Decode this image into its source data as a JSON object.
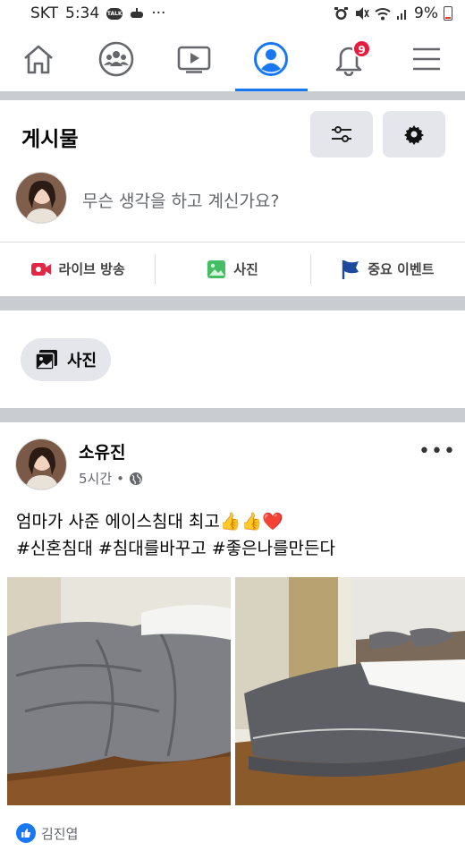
{
  "status_bar": {
    "carrier": "SKT",
    "time": "5:34",
    "more": "···",
    "battery": "9%"
  },
  "nav": {
    "items": [
      {
        "icon": "home-icon"
      },
      {
        "icon": "groups-icon"
      },
      {
        "icon": "watch-icon"
      },
      {
        "icon": "profile-icon",
        "active": true
      },
      {
        "icon": "bell-icon",
        "badge": "9"
      },
      {
        "icon": "menu-icon"
      }
    ],
    "accent": "#1877f2"
  },
  "posts_section": {
    "title": "게시물",
    "composer_placeholder": "무슨 생각을 하고 계신가요?",
    "actions": [
      {
        "label": "라이브 방송",
        "icon": "live-video-icon",
        "color": "#e42645"
      },
      {
        "label": "사진",
        "icon": "photo-icon",
        "color": "#45bd62"
      },
      {
        "label": "중요 이벤트",
        "icon": "flag-icon",
        "color": "#1d4a9c"
      }
    ]
  },
  "photos_chip": {
    "label": "사진"
  },
  "post": {
    "author": "소유진",
    "time": "5시간",
    "separator": "•",
    "text_line1": "엄마가 사준 에이스침대 최고👍👍❤️",
    "text_line2": "#신혼침대 #침대를바꾸고 #좋은나를만든다",
    "liker": "김진엽"
  }
}
